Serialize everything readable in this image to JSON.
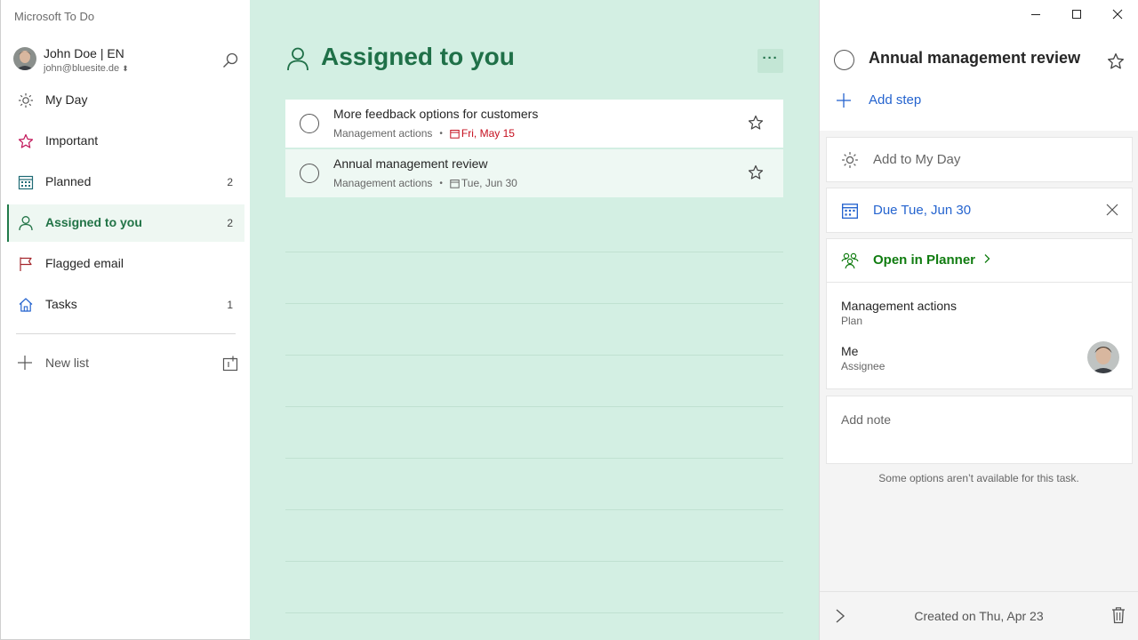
{
  "app": {
    "title": "Microsoft To Do"
  },
  "account": {
    "name": "John Doe | EN",
    "email": "john@bluesite.de",
    "email_chevron": "⌃⌄"
  },
  "sidebar": {
    "items": [
      {
        "label": "My Day",
        "count": "",
        "icon": "sun-icon"
      },
      {
        "label": "Important",
        "count": "",
        "icon": "star-icon"
      },
      {
        "label": "Planned",
        "count": "2",
        "icon": "calendar-grid-icon"
      },
      {
        "label": "Assigned to you",
        "count": "2",
        "icon": "person-icon",
        "active": true
      },
      {
        "label": "Flagged email",
        "count": "",
        "icon": "flag-icon"
      },
      {
        "label": "Tasks",
        "count": "1",
        "icon": "home-icon"
      }
    ],
    "new_list_label": "New list"
  },
  "main": {
    "title": "Assigned to you",
    "more_label": "···",
    "tasks": [
      {
        "title": "More feedback options for customers",
        "list": "Management actions",
        "due": "Fri, May 15",
        "overdue": true,
        "starred": false
      },
      {
        "title": "Annual management review",
        "list": "Management actions",
        "due": "Tue, Jun 30",
        "overdue": false,
        "starred": false
      }
    ]
  },
  "detail": {
    "title": "Annual management review",
    "add_step": "Add step",
    "add_to_my_day": "Add to My Day",
    "due": "Due Tue, Jun 30",
    "open_in_planner": "Open in Planner",
    "plan_name": "Management actions",
    "plan_label": "Plan",
    "assignee_name": "Me",
    "assignee_label": "Assignee",
    "note_placeholder": "Add note",
    "unavailable_msg": "Some options aren’t available for this task.",
    "created": "Created on Thu, Apr 23"
  },
  "colors": {
    "accent_green": "#217346",
    "main_bg": "#d3efe3",
    "link_blue": "#2564cf",
    "overdue_red": "#c50f1f",
    "planner_green": "#107c10"
  }
}
